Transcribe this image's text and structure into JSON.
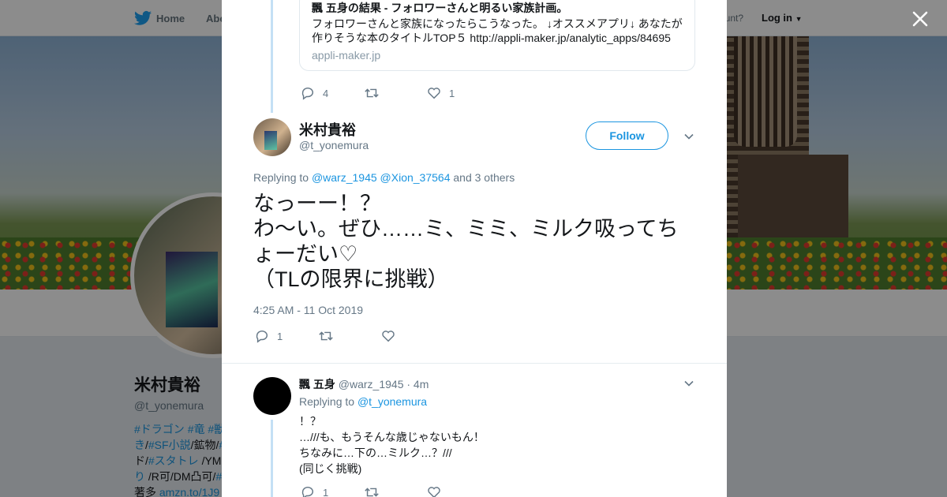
{
  "nav": {
    "home": "Home",
    "about": "Abo",
    "account_prompt": "ccount?",
    "login": "Log in"
  },
  "profile": {
    "name": "米村貴裕",
    "handle": "@t_yonemura",
    "bio_lines": [
      [
        {
          "text": "#ドラゴン",
          "link": true
        },
        {
          "text": " ",
          "link": false
        },
        {
          "text": "#竜",
          "link": true
        },
        {
          "text": " ",
          "link": false
        },
        {
          "text": "#獣",
          "link": true
        }
      ],
      [
        {
          "text": "き",
          "link": true
        },
        {
          "text": "/",
          "link": false
        },
        {
          "text": "#SF小説",
          "link": true
        },
        {
          "text": "/鉱物/",
          "link": false
        },
        {
          "text": "#",
          "link": true
        }
      ],
      [
        {
          "text": "ド/",
          "link": false
        },
        {
          "text": "#スタトレ",
          "link": true
        },
        {
          "text": " /YM",
          "link": false
        }
      ],
      [
        {
          "text": "り",
          "link": true
        },
        {
          "text": " /R可/DM凸可/",
          "link": false
        },
        {
          "text": "#",
          "link": true
        }
      ],
      [
        {
          "text": "著多 ",
          "link": false
        },
        {
          "text": "amzn.to/1J9",
          "link": true
        }
      ]
    ]
  },
  "modal": {
    "card": {
      "title": "飄 五身の結果 - フォロワーさんと明るい家族計画。",
      "description": "フォロワーさんと家族になったらこうなった。 ↓オススメアプリ↓ あなたが作りそうな本のタイトルTOP５ http://appli-maker.jp/analytic_apps/84695",
      "domain": "appli-maker.jp"
    },
    "prev_actions": {
      "replies": "4",
      "retweets": "",
      "likes": "1"
    },
    "main_tweet": {
      "name": "米村貴裕",
      "handle": "@t_yonemura",
      "follow_label": "Follow",
      "replying_prefix": "Replying to",
      "mention_1": "@warz_1945",
      "mention_2": "@Xion_37564",
      "others": "and 3 others",
      "text_lines": [
        "なっーー！？",
        "わ～い。ぜひ……ミ、ミミ、ミルク吸ってち",
        "ょーだい♡",
        "（TLの限界に挑戦）"
      ],
      "timestamp": "4:25 AM - 11 Oct 2019",
      "actions": {
        "replies": "1",
        "retweets": "",
        "likes": ""
      }
    },
    "reply": {
      "name": "飄 五身",
      "handle": "@warz_1945",
      "time": "· 4m",
      "replying_prefix": "Replying to",
      "mention": "@t_yonemura",
      "text_lines": [
        "！？",
        "…///も、もうそんな歳じゃないもん！",
        "ちなみに…下の…ミルク…？///",
        "(同じく挑戦)"
      ],
      "actions": {
        "replies": "1",
        "retweets": "",
        "likes": ""
      }
    }
  },
  "colors": {
    "accent": "#1b95e0",
    "thread_line": "#c4e0f5",
    "secondary_text": "#657786"
  }
}
